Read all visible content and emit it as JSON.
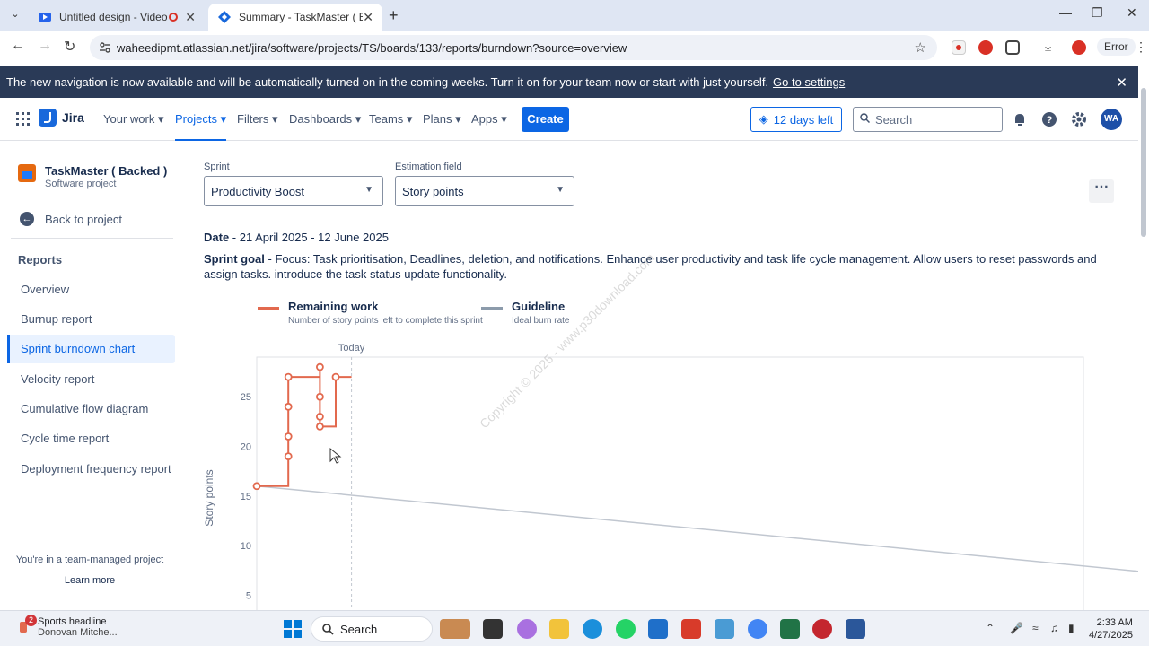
{
  "browser": {
    "tabs": [
      {
        "title": "Untitled design - Video - Ca"
      },
      {
        "title": "Summary - TaskMaster ( Backed )"
      }
    ],
    "url": "waheedipmt.atlassian.net/jira/software/projects/TS/boards/133/reports/burndown?source=overview",
    "error_label": "Error"
  },
  "banner": {
    "text": "The new navigation is now available and will be automatically turned on in the coming weeks. Turn it on for your team now or start with just yourself.",
    "link": "Go to settings"
  },
  "topnav": {
    "logo": "Jira",
    "items": [
      "Your work",
      "Projects",
      "Filters",
      "Dashboards",
      "Teams",
      "Plans",
      "Apps"
    ],
    "create": "Create",
    "trial": "12 days left",
    "search_placeholder": "Search",
    "avatar_initials": "WA"
  },
  "sidebar": {
    "project_name": "TaskMaster ( Backed )",
    "project_type": "Software project",
    "back": "Back to project",
    "section": "Reports",
    "items": [
      "Overview",
      "Burnup report",
      "Sprint burndown chart",
      "Velocity report",
      "Cumulative flow diagram",
      "Cycle time report",
      "Deployment frequency report"
    ],
    "selected_index": 2,
    "footer": "You're in a team-managed project",
    "learn_more": "Learn more"
  },
  "main": {
    "sprint_label": "Sprint",
    "sprint_value": "Productivity Boost",
    "estimation_label": "Estimation field",
    "estimation_value": "Story points",
    "date_label": "Date",
    "date_value": " - 21 April 2025 - 12 June 2025",
    "goal_label": "Sprint goal",
    "goal_value": " - Focus: Task prioritisation, Deadlines, deletion, and notifications. Enhance user productivity and task life cycle management. Allow users to reset passwords and assign tasks. introduce the task status update functionality.",
    "watermark": "Copyright © 2025 - www.p30download.com"
  },
  "chart_data": {
    "type": "line",
    "ylabel": "Story points",
    "today_label": "Today",
    "yticks": [
      5,
      10,
      15,
      20,
      25
    ],
    "ylim": [
      3.5,
      29
    ],
    "legend": [
      {
        "name": "Remaining work",
        "desc": "Number of story points left to complete this sprint",
        "color": "#e2694e"
      },
      {
        "name": "Guideline",
        "desc": "Ideal burn rate",
        "color": "#8c9bab"
      }
    ],
    "series": [
      {
        "name": "Remaining work",
        "color": "#e2694e",
        "points": [
          {
            "x": 0,
            "y": 16,
            "m": 1
          },
          {
            "x": 1,
            "y": 16,
            "m": 0
          },
          {
            "x": 1,
            "y": 19,
            "m": 1
          },
          {
            "x": 1,
            "y": 21,
            "m": 1
          },
          {
            "x": 1,
            "y": 24,
            "m": 1
          },
          {
            "x": 1,
            "y": 27,
            "m": 1
          },
          {
            "x": 2,
            "y": 27,
            "m": 0
          },
          {
            "x": 2,
            "y": 28,
            "m": 1
          },
          {
            "x": 2,
            "y": 25,
            "m": 1
          },
          {
            "x": 2,
            "y": 23,
            "m": 1
          },
          {
            "x": 2,
            "y": 22,
            "m": 1
          },
          {
            "x": 2.5,
            "y": 22,
            "m": 0
          },
          {
            "x": 2.5,
            "y": 27,
            "m": 1
          },
          {
            "x": 3,
            "y": 27,
            "m": 0
          }
        ]
      },
      {
        "name": "Guideline",
        "color": "#c1c7d0",
        "points": [
          {
            "x": 0,
            "y": 16
          },
          {
            "x": 52,
            "y": 0
          }
        ]
      }
    ],
    "today_x": 3
  },
  "taskbar": {
    "news_title": "Sports headline",
    "news_sub": "Donovan Mitche...",
    "news_badge": "2",
    "search": "Search",
    "time": "2:33 AM",
    "date": "4/27/2025"
  }
}
